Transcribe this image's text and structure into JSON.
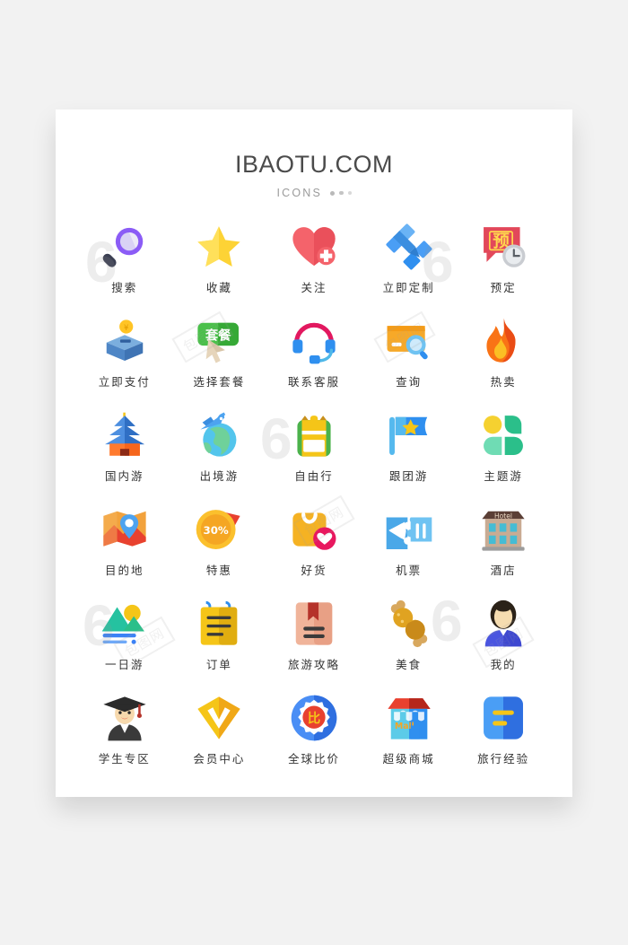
{
  "page": {
    "background_color": "#f2f2f2",
    "card_color": "#ffffff"
  },
  "header": {
    "brand": "IBAOTU.COM",
    "subtitle": "ICONS",
    "dots": [
      "dot",
      "dot",
      "dot"
    ]
  },
  "icons": [
    {
      "id": "search",
      "label": "搜索",
      "icon_name": "magnifier-icon",
      "colors": [
        "#8b5cf6",
        "#cfc3f7",
        "#3b3f52"
      ]
    },
    {
      "id": "favorite",
      "label": "收藏",
      "icon_name": "star-icon",
      "colors": [
        "#fdd335",
        "#f5a623"
      ]
    },
    {
      "id": "follow",
      "label": "关注",
      "icon_name": "heart-plus-icon",
      "colors": [
        "#f4636b",
        "#e8464f"
      ]
    },
    {
      "id": "customize-now",
      "label": "立即定制",
      "icon_name": "pen-ruler-icon",
      "colors": [
        "#4da3f0",
        "#3b8ee0"
      ]
    },
    {
      "id": "reserve",
      "label": "预定",
      "icon_name": "speech-clock-icon",
      "colors": [
        "#e2485a",
        "#ffd84d",
        "#8c9096"
      ]
    },
    {
      "id": "pay-now",
      "label": "立即支付",
      "icon_name": "coin-box-icon",
      "colors": [
        "#4e86c6",
        "#7baede",
        "#ffc425"
      ]
    },
    {
      "id": "select-plan",
      "label": "选择套餐",
      "icon_name": "plan-tag-cursor-icon",
      "colors": [
        "#4ac04a",
        "#36a936",
        "#e6d5bb"
      ],
      "badge_text": "套餐"
    },
    {
      "id": "contact",
      "label": "联系客服",
      "icon_name": "headset-icon",
      "colors": [
        "#e2185f",
        "#2f8fef",
        "#4fb8e8"
      ]
    },
    {
      "id": "query",
      "label": "查询",
      "icon_name": "card-search-icon",
      "colors": [
        "#f7a928",
        "#f59b15",
        "#4aa8e8"
      ]
    },
    {
      "id": "hot-sale",
      "label": "热卖",
      "icon_name": "flame-icon",
      "colors": [
        "#f97316",
        "#fbbf24",
        "#ea4c15"
      ]
    },
    {
      "id": "domestic",
      "label": "国内游",
      "icon_name": "temple-icon",
      "colors": [
        "#4d8fe0",
        "#2f6fc4",
        "#f5651c",
        "#ff7a2e"
      ]
    },
    {
      "id": "outbound",
      "label": "出境游",
      "icon_name": "plane-globe-icon",
      "colors": [
        "#4da3f0",
        "#53c5ec",
        "#6fd19a"
      ]
    },
    {
      "id": "self-travel",
      "label": "自由行",
      "icon_name": "backpack-icon",
      "colors": [
        "#f5c518",
        "#4bb24b",
        "#c8901c"
      ]
    },
    {
      "id": "group-tour",
      "label": "跟团游",
      "icon_name": "flag-star-icon",
      "colors": [
        "#55b9ee",
        "#2f8fef",
        "#f5c518"
      ]
    },
    {
      "id": "theme-tour",
      "label": "主题游",
      "icon_name": "clover-icon",
      "colors": [
        "#f5d130",
        "#2bbf8a",
        "#6fdcb4"
      ]
    },
    {
      "id": "destination",
      "label": "目的地",
      "icon_name": "map-pin-icon",
      "colors": [
        "#f2a23c",
        "#e8412f",
        "#4da3f0"
      ]
    },
    {
      "id": "discount",
      "label": "特惠",
      "icon_name": "discount-badge-icon",
      "colors": [
        "#fbc02d",
        "#f0a818",
        "#e8412f"
      ],
      "badge_text": "30%"
    },
    {
      "id": "good-deals",
      "label": "好货",
      "icon_name": "shopping-bag-heart-icon",
      "colors": [
        "#f5b223",
        "#e8185f"
      ]
    },
    {
      "id": "air-ticket",
      "label": "机票",
      "icon_name": "plane-ticket-icon",
      "colors": [
        "#4aa8e8",
        "#6fc3f2"
      ]
    },
    {
      "id": "hotel",
      "label": "酒店",
      "icon_name": "hotel-building-icon",
      "colors": [
        "#5b3f36",
        "#c9ab93",
        "#45bcd4"
      ],
      "badge_text": "Hotel"
    },
    {
      "id": "one-day-tour",
      "label": "一日游",
      "icon_name": "mountain-sun-icon",
      "colors": [
        "#25c2a0",
        "#f5c518",
        "#3b82f6"
      ]
    },
    {
      "id": "orders",
      "label": "订单",
      "icon_name": "notepad-icon",
      "colors": [
        "#f5c518",
        "#e0ad10",
        "#2f8fef"
      ]
    },
    {
      "id": "travel-guide",
      "label": "旅游攻略",
      "icon_name": "book-bookmark-icon",
      "colors": [
        "#f0b49a",
        "#e8a085",
        "#b5332a"
      ]
    },
    {
      "id": "food",
      "label": "美食",
      "icon_name": "drumstick-icon",
      "colors": [
        "#e0a321",
        "#c98a1a",
        "#d8a85e"
      ]
    },
    {
      "id": "mine",
      "label": "我的",
      "icon_name": "user-avatar-icon",
      "colors": [
        "#2b2218",
        "#f5dcb0",
        "#4a55e0"
      ]
    },
    {
      "id": "student-zone",
      "label": "学生专区",
      "icon_name": "graduate-icon",
      "colors": [
        "#2b2b2b",
        "#f7d9ad",
        "#b5332a"
      ]
    },
    {
      "id": "member-center",
      "label": "会员中心",
      "icon_name": "diamond-v-icon",
      "colors": [
        "#f5c518",
        "#f0a818"
      ]
    },
    {
      "id": "price-compare",
      "label": "全球比价",
      "icon_name": "compare-badge-icon",
      "colors": [
        "#2f6fe0",
        "#4a8ef5",
        "#e8412f",
        "#f5c518"
      ],
      "badge_text": "比"
    },
    {
      "id": "super-mall",
      "label": "超级商城",
      "icon_name": "mall-shop-icon",
      "colors": [
        "#e8412f",
        "#b5271c",
        "#5ccbe8",
        "#2f8fef",
        "#f5a623"
      ],
      "badge_text": "Mall"
    },
    {
      "id": "travel-exp",
      "label": "旅行经验",
      "icon_name": "blue-doc-icon",
      "colors": [
        "#4a9ef5",
        "#2f6fe0",
        "#f5c518"
      ]
    }
  ],
  "watermarks": {
    "mark_text": "包图网",
    "logo_glyph": "6"
  }
}
